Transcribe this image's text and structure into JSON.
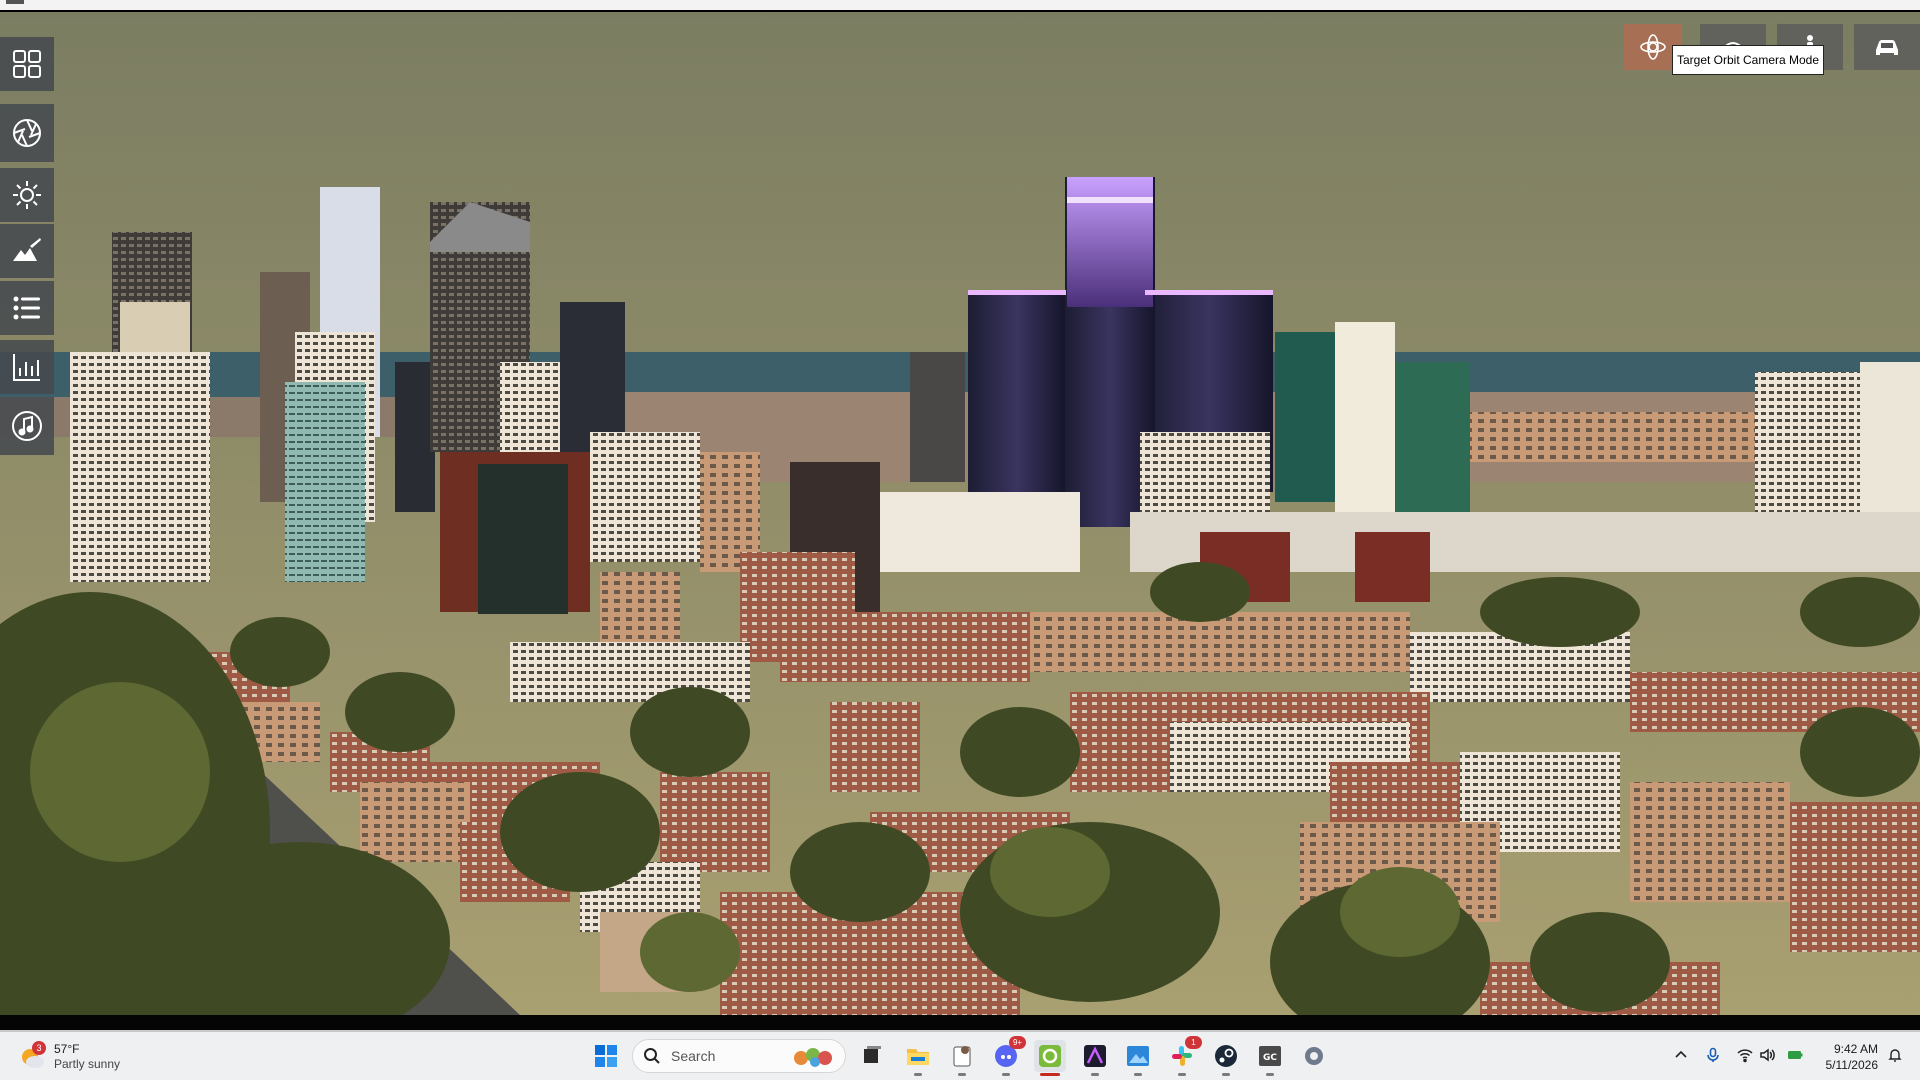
{
  "tooltip": {
    "text": "Target Orbit Camera Mode"
  },
  "left_toolbar": [
    {
      "name": "grid-icon"
    },
    {
      "name": "aperture-icon"
    },
    {
      "name": "sun-icon"
    },
    {
      "name": "terrain-brush-icon"
    },
    {
      "name": "list-icon"
    },
    {
      "name": "statistics-icon"
    },
    {
      "name": "music-icon"
    }
  ],
  "camera_buttons": [
    {
      "name": "target-orbit-camera-icon",
      "active": true
    },
    {
      "name": "free-camera-icon",
      "active": false
    },
    {
      "name": "first-person-camera-icon",
      "active": false
    },
    {
      "name": "vehicle-camera-icon",
      "active": false
    }
  ],
  "taskbar": {
    "weather": {
      "badge": "3",
      "temp": "57°F",
      "condition": "Partly sunny"
    },
    "search": {
      "label": "Search"
    },
    "apps": [
      {
        "name": "windows-start-icon",
        "running": false
      },
      {
        "name": "task-view-icon",
        "running": false
      },
      {
        "name": "file-explorer-icon",
        "running": true
      },
      {
        "name": "phone-link-icon",
        "running": true
      },
      {
        "name": "discord-icon",
        "running": true,
        "badge": "9+"
      },
      {
        "name": "game-app-icon",
        "running": true,
        "active": true
      },
      {
        "name": "affinity-icon",
        "running": true
      },
      {
        "name": "photo-editor-icon",
        "running": true
      },
      {
        "name": "slack-icon",
        "running": true,
        "badge": "1"
      },
      {
        "name": "steam-icon",
        "running": true
      },
      {
        "name": "gc-app-icon",
        "running": true
      },
      {
        "name": "settings-icon",
        "running": false
      }
    ],
    "tray": [
      {
        "name": "chevron-up-icon"
      },
      {
        "name": "microphone-icon"
      },
      {
        "name": "wifi-icon"
      },
      {
        "name": "volume-icon"
      },
      {
        "name": "battery-icon"
      }
    ],
    "clock": {
      "time": "9:42 AM",
      "date": "5/11/2026"
    }
  },
  "colors": {
    "sky_top": "#7b7d62",
    "sky_bottom": "#a9a071",
    "lake": "#3d5f6a",
    "active_camera": "#a77055",
    "taskbar_bg": "#eef0f2",
    "tower_glow": "#c07cff"
  }
}
